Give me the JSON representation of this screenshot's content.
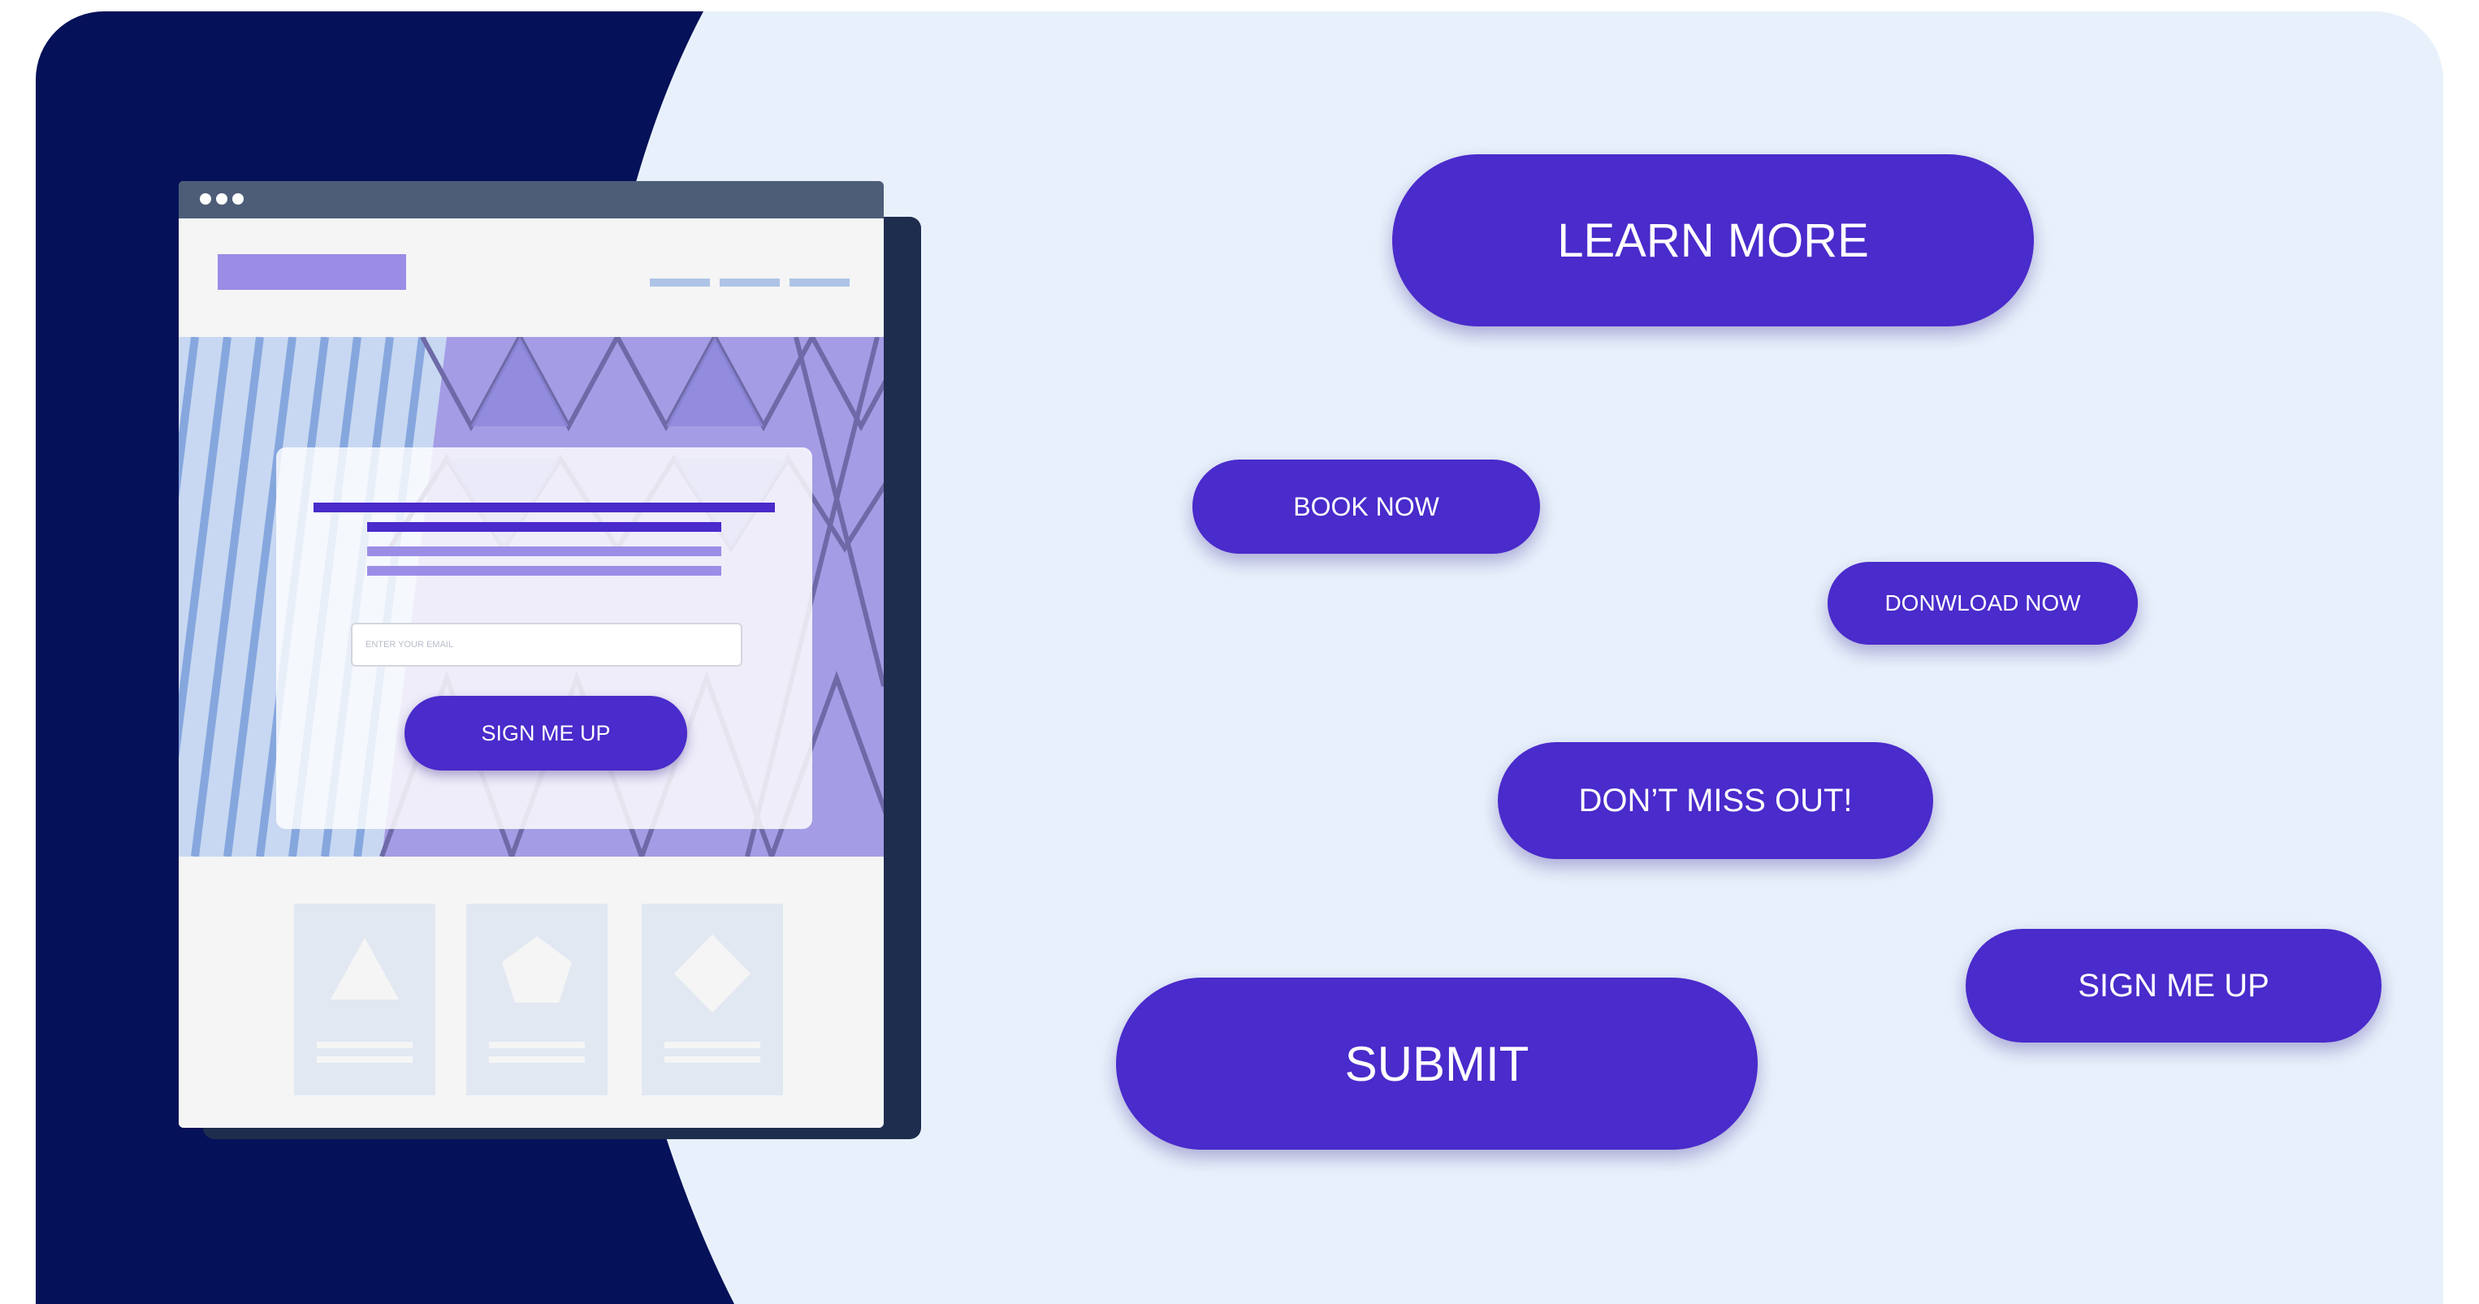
{
  "colors": {
    "dark_panel": "#051158",
    "light_panel": "#e8f1fb",
    "button": "#4a2bcb",
    "button_text": "#ffffff",
    "mock_accent": "#9b8de6"
  },
  "mock_page": {
    "email_placeholder": "ENTER YOUR EMAIL",
    "cta_label": "SIGN ME UP",
    "feature_icons": [
      "triangle-icon",
      "pentagon-icon",
      "diamond-icon"
    ]
  },
  "buttons": {
    "learn_more": "LEARN MORE",
    "book_now": "BOOK NOW",
    "download_now": "DONWLOAD NOW",
    "dont_miss_out": "DON’T MISS OUT!",
    "sign_me_up": "SIGN ME UP",
    "submit": "SUBMIT"
  }
}
